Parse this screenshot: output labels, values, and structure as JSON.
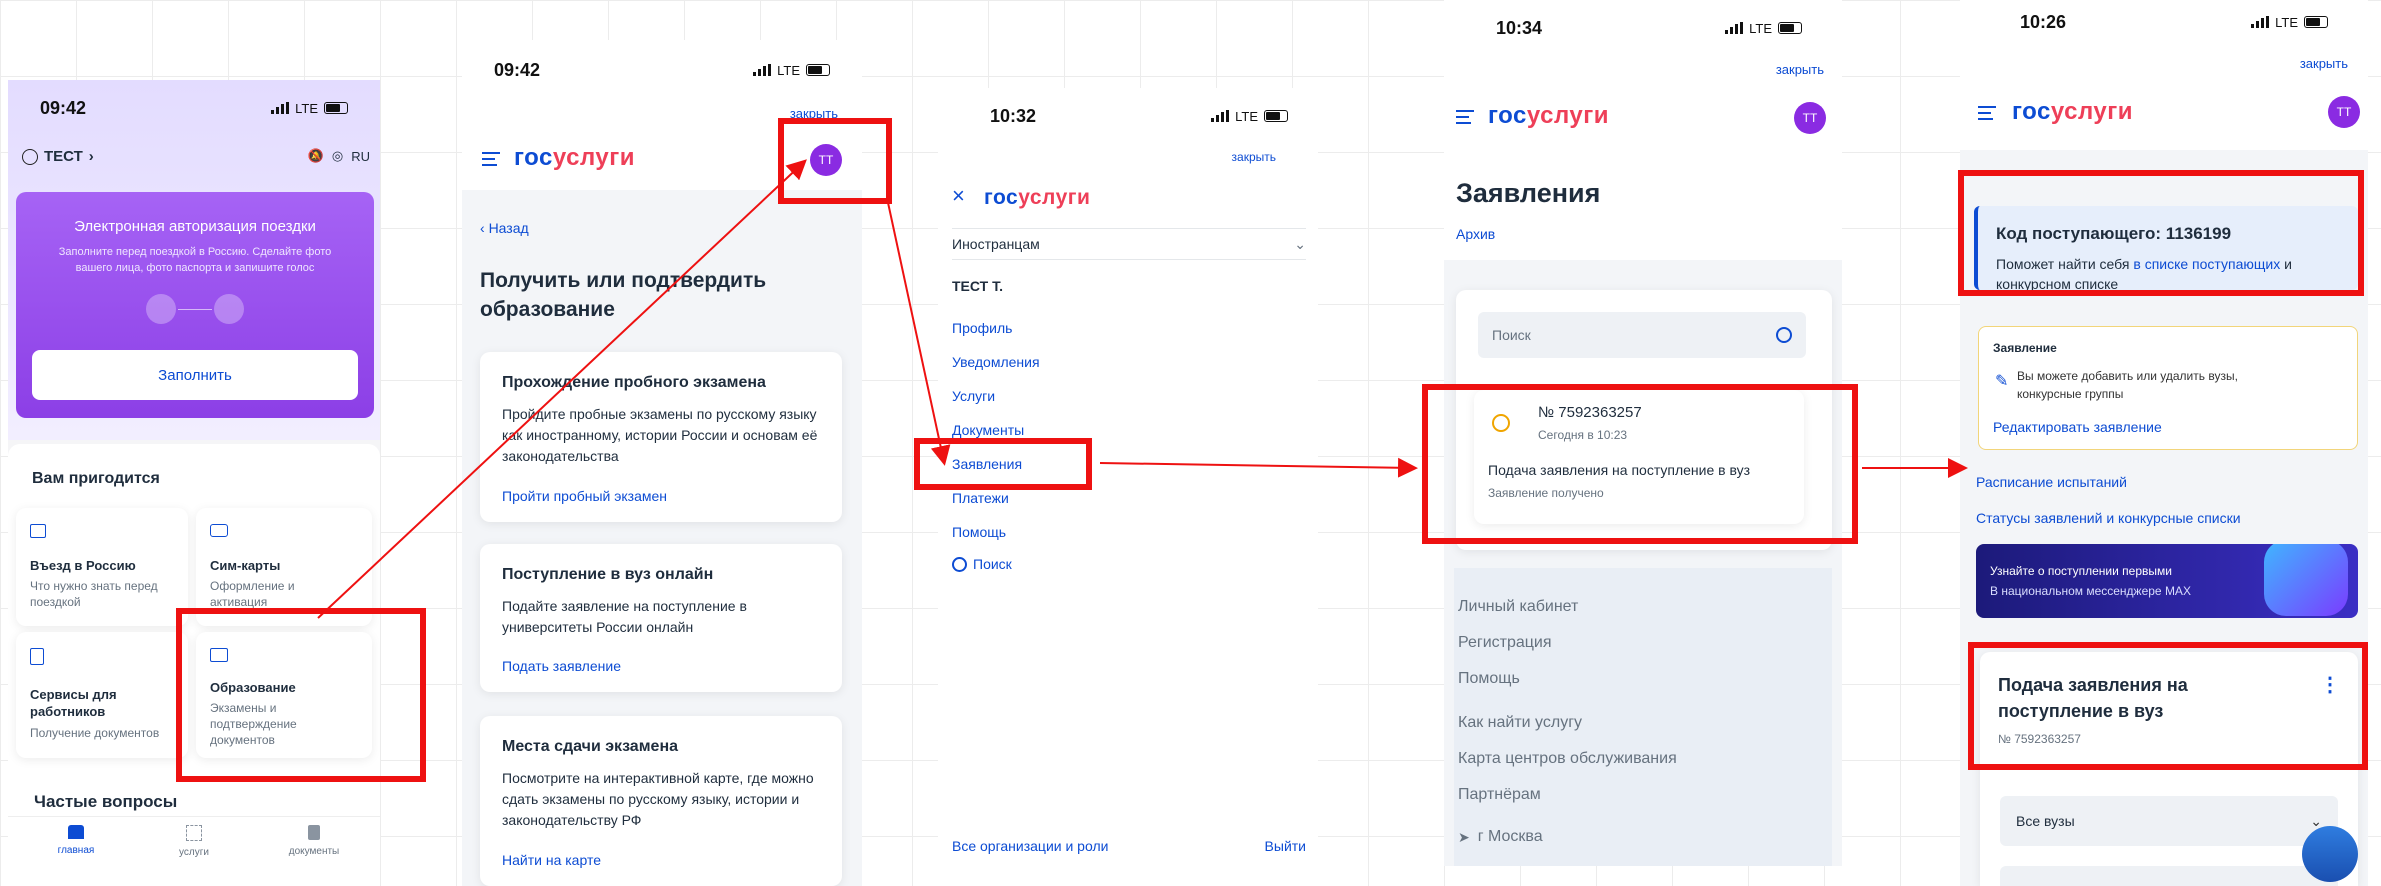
{
  "screen1": {
    "time": "09:42",
    "lte": "LTE",
    "user": "ТЕСТ",
    "lang": "RU",
    "banner": {
      "title": "Электронная авторизация поездки",
      "text": "Заполните перед поездкой в Россию. Сделайте фото вашего лица, фото паспорта и запишите голос",
      "button": "Заполнить"
    },
    "section_title": "Вам пригодится",
    "tiles": [
      {
        "title": "Въезд в Россию",
        "desc": "Что нужно знать перед поездкой"
      },
      {
        "title": "Сим-карты",
        "desc": "Оформление и активация"
      },
      {
        "title": "Сервисы для работников",
        "desc": "Получение документов"
      },
      {
        "title": "Образование",
        "desc": "Экзамены и подтверждение документов"
      }
    ],
    "faq_title": "Частые вопросы",
    "tabbar": [
      "главная",
      "услуги",
      "документы"
    ]
  },
  "screen2": {
    "time": "09:42",
    "lte": "LTE",
    "close": "закрыть",
    "logo_a": "гос",
    "logo_b": "услуги",
    "avatar": "ТТ",
    "back": "Назад",
    "heading": "Получить или подтвердить образование",
    "cards": [
      {
        "title": "Прохождение пробного экзамена",
        "text": "Пройдите пробные экзамены по русскому языку как иностранному, истории России и основам её законодательства",
        "link": "Пройти пробный экзамен"
      },
      {
        "title": "Поступление в вуз онлайн",
        "text": "Подайте заявление на поступление в университеты России онлайн",
        "link": "Подать заявление"
      },
      {
        "title": "Места сдачи экзамена",
        "text": "Посмотрите на интерактивной карте, где можно сдать экзамены по русскому языку, истории и законодательству РФ",
        "link": "Найти на карте"
      }
    ]
  },
  "screen3": {
    "time": "10:32",
    "lte": "LTE",
    "close": "закрыть",
    "logo_a": "гос",
    "logo_b": "услуги",
    "dropdown": "Иностранцам",
    "user": "ТЕСТ Т.",
    "menu": [
      "Профиль",
      "Уведомления",
      "Услуги",
      "Документы",
      "Заявления",
      "Платежи",
      "Помощь",
      "Поиск"
    ],
    "footer_left": "Все организации и роли",
    "footer_right": "Выйти"
  },
  "screen4": {
    "time": "10:34",
    "lte": "LTE",
    "close": "закрыть",
    "logo_a": "гос",
    "logo_b": "услуги",
    "avatar": "ТТ",
    "heading": "Заявления",
    "archive": "Архив",
    "search_placeholder": "Поиск",
    "app_number": "№ 7592363257",
    "app_date": "Сегодня в 10:23",
    "app_title": "Подача заявления на поступление в вуз",
    "app_status": "Заявление получено",
    "footer": [
      "Личный кабинет",
      "Регистрация",
      "Помощь",
      "Как найти услугу",
      "Карта центров обслуживания",
      "Партнёрам"
    ],
    "city": "г Москва"
  },
  "screen5": {
    "time": "10:26",
    "lte": "LTE",
    "close": "закрыть",
    "logo_a": "гос",
    "logo_b": "услуги",
    "avatar": "ТТ",
    "code_title": "Код поступающего: 1136199",
    "code_text_a": "Поможет найти себя ",
    "code_link": "в списке поступающих",
    "code_text_b": " и конкурсном списке",
    "app_label": "Заявление",
    "app_text": "Вы можете добавить или удалить вузы, конкурсные группы",
    "app_edit": "Редактировать заявление",
    "link_schedule": "Расписание испытаний",
    "link_status": "Статусы заявлений и конкурсные списки",
    "max_title": "Узнайте о поступлении первыми",
    "max_text": "В национальном мессенджере MAX",
    "card_title": "Подача заявления на поступление в вуз",
    "card_number": "№ 7592363257",
    "select_label": "Все вузы"
  }
}
